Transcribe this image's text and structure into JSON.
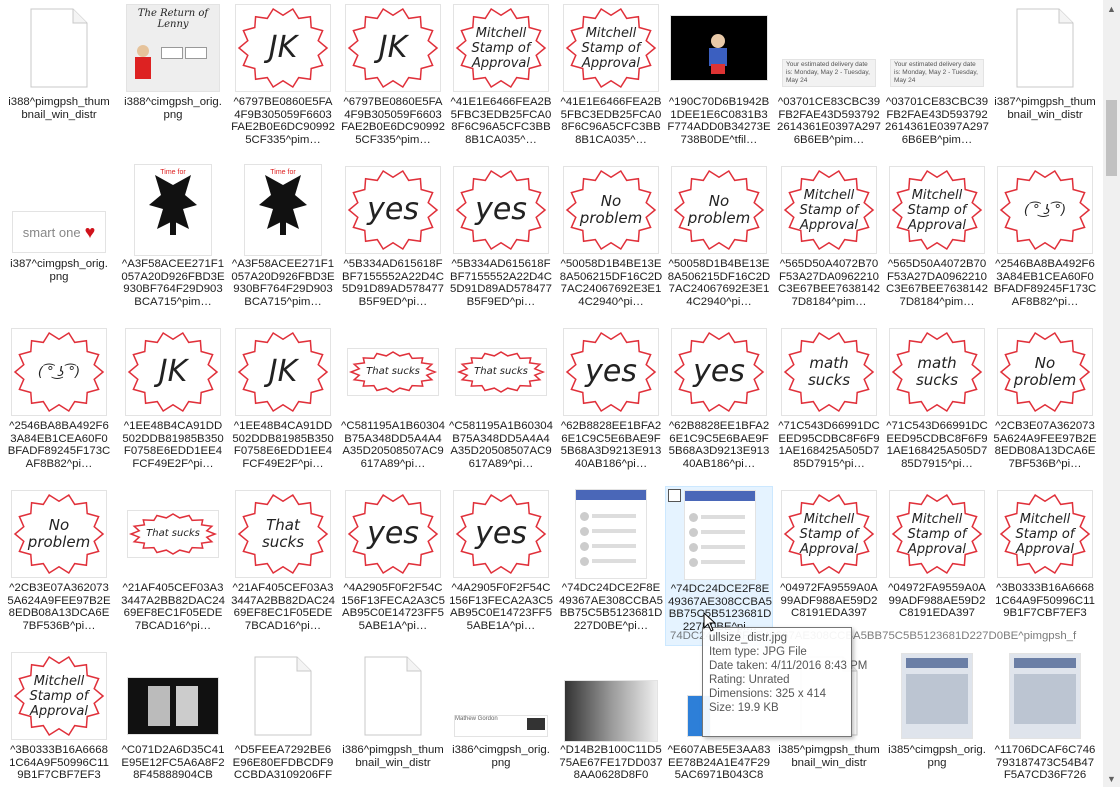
{
  "files": [
    {
      "label": "i388^pimgpsh_thumbnail_win_distr",
      "thumb": "doc"
    },
    {
      "label": "i388^cimgpsh_orig.png",
      "thumb": "lenny",
      "title": "The Return of Lenny"
    },
    {
      "label": "^6797BE0860E5FA4F9B305059F6603FAE2B0E6DC909925CF335^pim…",
      "thumb": "stamp",
      "text": "JK"
    },
    {
      "label": "^6797BE0860E5FA4F9B305059F6603FAE2B0E6DC909925CF335^pim…",
      "thumb": "stamp",
      "text": "JK"
    },
    {
      "label": "^41E1E6466FEA2B5FBC3EDB25FCA08F6C96A5CFC3BB8B1CA035^…",
      "thumb": "stamp",
      "text": "Mitchell Stamp of Approval"
    },
    {
      "label": "^41E1E6466FEA2B5FBC3EDB25FCA08F6C96A5CFC3BB8B1CA035^…",
      "thumb": "stamp",
      "text": "Mitchell Stamp of Approval"
    },
    {
      "label": "^190C70D6B1942B1DEE1E6C0831B3F774ADD0B34273E738B0DE^tfil…",
      "thumb": "black"
    },
    {
      "label": "^03701CE83CBC39FB2FAE43D5937922614361E0397A2976B6EB^pim…",
      "thumb": "delivery",
      "text": "Your estimated delivery date is: Monday, May 2 - Tuesday, May 24"
    },
    {
      "label": "^03701CE83CBC39FB2FAE43D5937922614361E0397A2976B6EB^pim…",
      "thumb": "delivery",
      "text": "Your estimated delivery date is: Monday, May 2 - Tuesday, May 24"
    },
    {
      "label": "i387^pimgpsh_thumbnail_win_distr",
      "thumb": "doc"
    },
    {
      "label": "i387^cimgpsh_orig.png",
      "thumb": "smartone",
      "text": "smart one"
    },
    {
      "label": "^A3F58ACEE271F1057A20D926FBD3E930BF764F29D903BCA715^pim…",
      "thumb": "skyrim",
      "text": "Time for"
    },
    {
      "label": "^A3F58ACEE271F1057A20D926FBD3E930BF764F29D903BCA715^pim…",
      "thumb": "skyrim",
      "text": "Time for"
    },
    {
      "label": "^5B334AD615618FBF7155552A22D4C5D91D89AD578477B5F9ED^pi…",
      "thumb": "stamp",
      "text": "yes"
    },
    {
      "label": "^5B334AD615618FBF7155552A22D4C5D91D89AD578477B5F9ED^pi…",
      "thumb": "stamp",
      "text": "yes"
    },
    {
      "label": "^50058D1B4BE13E8A506215DF16C2D7AC24067692E3E14C2940^pi…",
      "thumb": "stamp",
      "text": "No problem"
    },
    {
      "label": "^50058D1B4BE13E8A506215DF16C2D7AC24067692E3E14C2940^pi…",
      "thumb": "stamp",
      "text": "No problem"
    },
    {
      "label": "^565D50A4072B70F53A27DA0962210C3E67BEE76381427D8184^pim…",
      "thumb": "stamp",
      "text": "Mitchell Stamp of Approval"
    },
    {
      "label": "^565D50A4072B70F53A27DA0962210C3E67BEE76381427D8184^pim…",
      "thumb": "stamp",
      "text": "Mitchell Stamp of Approval"
    },
    {
      "label": "^2546BA8BA492F63A84EB1CEA60F0BFADF89245F173CAF8B82^pi…",
      "thumb": "stamp",
      "text": "( ͡° ͜ʖ ͡°)"
    },
    {
      "label": "^2546BA8BA492F63A84EB1CEA60F0BFADF89245F173CAF8B82^pi…",
      "thumb": "stamp",
      "text": "( ͡° ͜ʖ ͡°)"
    },
    {
      "label": "^1EE48B4CA91DD502DDB81985B350F0758E6EDD1EE4FCF49E2F^pi…",
      "thumb": "stamp",
      "text": "JK"
    },
    {
      "label": "^1EE48B4CA91DD502DDB81985B350F0758E6EDD1EE4FCF49E2F^pi…",
      "thumb": "stamp",
      "text": "JK"
    },
    {
      "label": "^C581195A1B60304B75A348DD5A4A4A35D20508507AC9617A89^pi…",
      "thumb": "stampsmall",
      "text": "That sucks"
    },
    {
      "label": "^C581195A1B60304B75A348DD5A4A4A35D20508507AC9617A89^pi…",
      "thumb": "stampsmall",
      "text": "That sucks"
    },
    {
      "label": "^62B8828EE1BFA26E1C9C5E6BAE9F5B68A3D9213E91340AB186^pi…",
      "thumb": "stamp",
      "text": "yes"
    },
    {
      "label": "^62B8828EE1BFA26E1C9C5E6BAE9F5B68A3D9213E91340AB186^pi…",
      "thumb": "stamp",
      "text": "yes"
    },
    {
      "label": "^71C543D66991DCEED95CDBC8F6F91AE168425A505D785D7915^pi…",
      "thumb": "stamp",
      "text": "math sucks"
    },
    {
      "label": "^71C543D66991DCEED95CDBC8F6F91AE168425A505D785D7915^pi…",
      "thumb": "stamp",
      "text": "math sucks"
    },
    {
      "label": "^2CB3E07A3620735A624A9FEE97B2E8EDB08A13DCA6E7BF536B^pi…",
      "thumb": "stamp",
      "text": "No problem"
    },
    {
      "label": "^2CB3E07A3620735A624A9FEE97B2E8EDB08A13DCA6E7BF536B^pi…",
      "thumb": "stamp",
      "text": "No problem"
    },
    {
      "label": "^21AF405CEF03A33447A2BB82DAC2469EF8EC1F05EDE7BCAD16^pi…",
      "thumb": "stampsmall",
      "text": "That sucks"
    },
    {
      "label": "^21AF405CEF03A33447A2BB82DAC2469EF8EC1F05EDE7BCAD16^pi…",
      "thumb": "stamp",
      "text": "That sucks"
    },
    {
      "label": "^4A2905F0F2F54C156F13FECA2A3C5AB95C0E14723FF55ABE1A^pi…",
      "thumb": "stamp",
      "text": "yes"
    },
    {
      "label": "^4A2905F0F2F54C156F13FECA2A3C5AB95C0E14723FF55ABE1A^pi…",
      "thumb": "stamp",
      "text": "yes"
    },
    {
      "label": "^74DC24DCE2F8E49367AE308CCBA5BB75C5B5123681D227D0BE^pi…",
      "thumb": "phone"
    },
    {
      "label": "^74DC24DCE2F8E49367AE308CCBA5BB75C5B5123681D227D0BE^pi…",
      "thumb": "phone",
      "selected": true
    },
    {
      "label": "^04972FA9559A0A99ADF988AE59D2C8191EDA397",
      "thumb": "stamp",
      "text": "Mitchell Stamp of Approval"
    },
    {
      "label": "^04972FA9559A0A99ADF988AE59D2C8191EDA397",
      "thumb": "stamp",
      "text": "Mitchell Stamp of Approval"
    },
    {
      "label": "^3B0333B16A66681C64A9F50996C119B1F7CBF7EF3",
      "thumb": "stamp",
      "text": "Mitchell Stamp of Approval"
    },
    {
      "label": "^3B0333B16A66681C64A9F50996C119B1F7CBF7EF3",
      "thumb": "stamp",
      "text": "Mitchell Stamp of Approval"
    },
    {
      "label": "^C071D2A6D35C41E95E12FC5A6A8F28F45888904CB",
      "thumb": "photo"
    },
    {
      "label": "^D5FEEA7292BE6E96E80EFDBCDF9CCBDA3109206FF",
      "thumb": "doc"
    },
    {
      "label": "i386^pimgpsh_thumbnail_win_distr",
      "thumb": "doc"
    },
    {
      "label": "i386^cimgpsh_orig.png",
      "thumb": "msgbar",
      "text": "Mathew Gordon"
    },
    {
      "label": "^D14B2B100C11D575AE67FE17DD0378AA0628D8F0",
      "thumb": "gray"
    },
    {
      "label": "^E607ABE5E3AA83EE78B24A1E47F295AC6971B043C8",
      "thumb": "blue"
    },
    {
      "label": "i385^pimgpsh_thumbnail_win_distr",
      "thumb": "doc"
    },
    {
      "label": "i385^cimgpsh_orig.png",
      "thumb": "screenshot"
    },
    {
      "label": "^11706DCAF6C746793187473C54B47F5A7CD36F726",
      "thumb": "screenshot2"
    }
  ],
  "overlay_text": "74DC24DCE2F8E49367AE308CCBA5BB75C5B5123681D227D0BE^pimgpsh_f",
  "tooltip": {
    "name": "ullsize_distr.jpg",
    "type": "Item type: JPG File",
    "date": "Date taken: 4/11/2016 8:43 PM",
    "rating": "Rating: Unrated",
    "dims": "Dimensions: 325 x 414",
    "size": "Size: 19.9 KB"
  },
  "colors": {
    "stamp_red": "#e0303a",
    "ink": "#222222",
    "selection": "#e5f3ff"
  }
}
